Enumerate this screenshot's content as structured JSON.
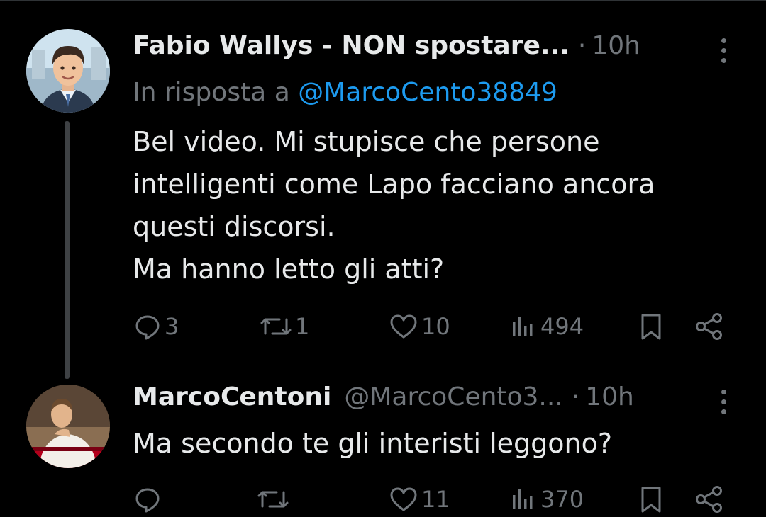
{
  "tweets": [
    {
      "author_name": "Fabio Wallys - NON spostare...",
      "time": "10h",
      "reply_prefix": "In risposta a",
      "reply_handle": "@MarcoCento38849",
      "text_lines": [
        "Bel video. Mi stupisce che persone",
        "intelligenti come Lapo facciano ancora",
        "questi discorsi.",
        "Ma hanno letto gli atti?"
      ],
      "replies": "3",
      "retweets": "1",
      "likes": "10",
      "views": "494"
    },
    {
      "author_name": "MarcoCentoni",
      "handle": "@MarcoCento3...",
      "time": "10h",
      "text_lines": [
        "Ma secondo te gli interisti leggono?"
      ],
      "replies": "",
      "retweets": "",
      "likes": "11",
      "views": "370"
    }
  ],
  "separator": "·",
  "colors": {
    "background": "#000000",
    "primary_text": "#e7e9ea",
    "secondary_text": "#71767b",
    "link": "#1d9bf0"
  },
  "icons": [
    "reply-icon",
    "retweet-icon",
    "like-icon",
    "views-icon",
    "bookmark-icon",
    "share-icon",
    "more-icon"
  ]
}
